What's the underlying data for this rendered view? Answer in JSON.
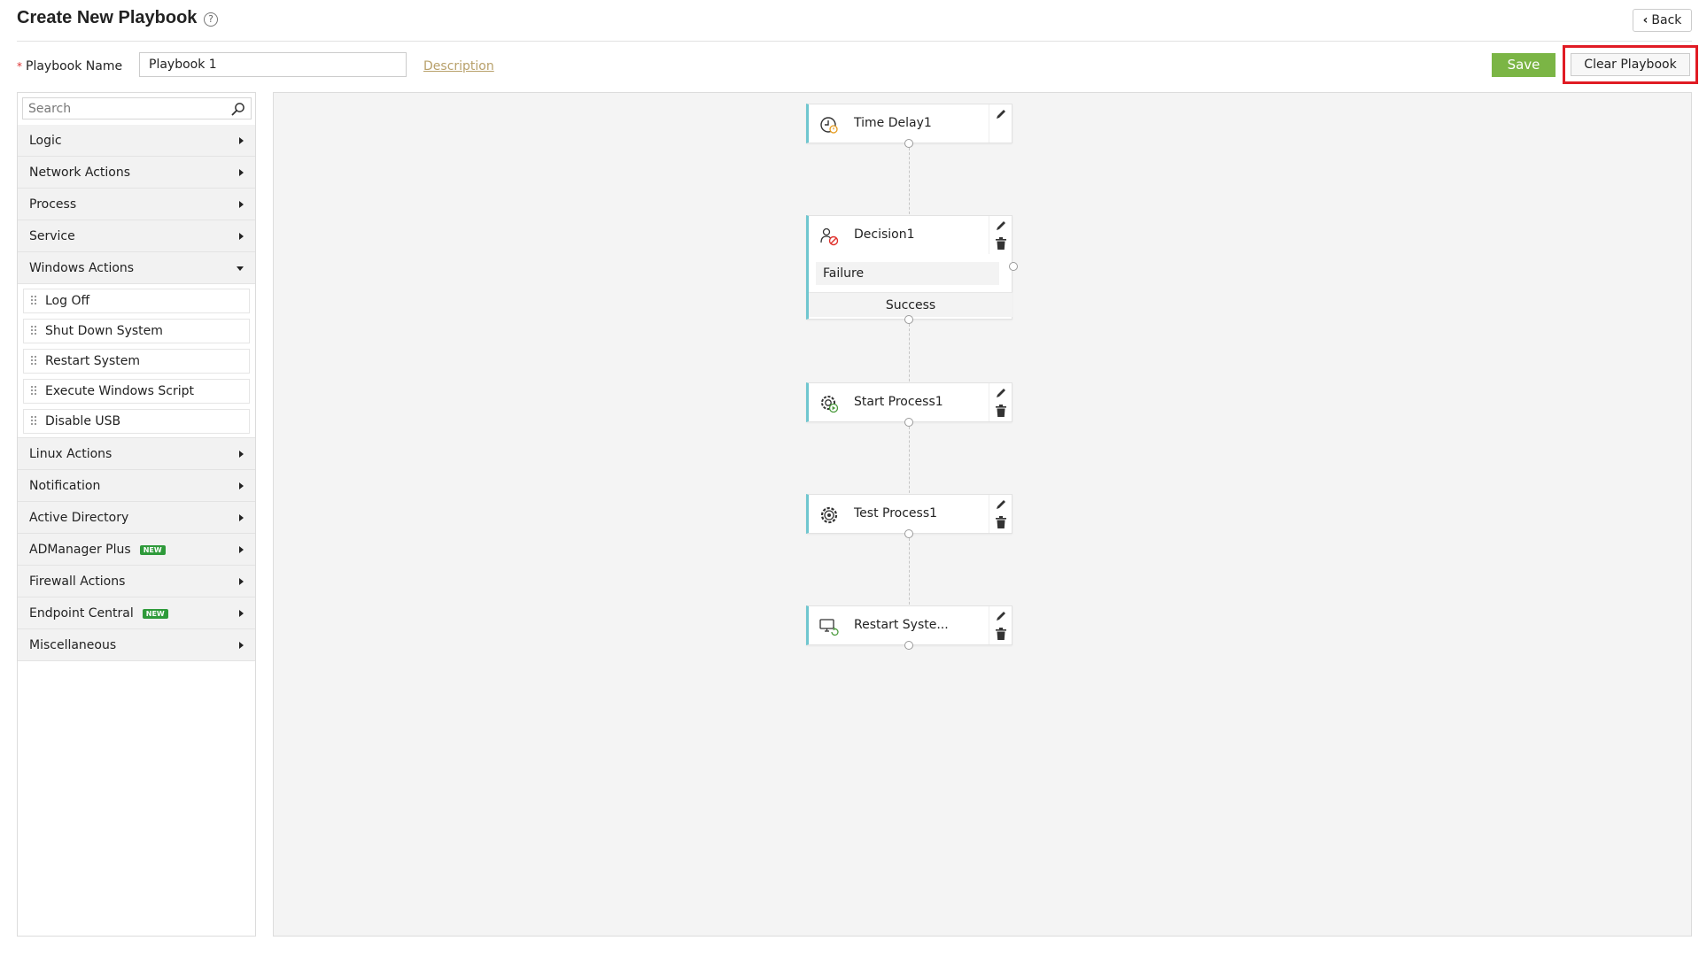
{
  "header": {
    "title": "Create New Playbook",
    "help_glyph": "?",
    "back_label": "Back"
  },
  "form": {
    "name_label": "Playbook Name",
    "required_mark": "*",
    "name_value": "Playbook 1",
    "description_link": "Description",
    "save_label": "Save",
    "clear_label": "Clear Playbook"
  },
  "sidebar": {
    "search_placeholder": "Search",
    "categories_top": [
      {
        "label": "Logic"
      },
      {
        "label": "Network Actions"
      },
      {
        "label": "Process"
      },
      {
        "label": "Service"
      }
    ],
    "expanded": {
      "label": "Windows Actions",
      "items": [
        "Log Off",
        "Shut Down System",
        "Restart System",
        "Execute Windows Script",
        "Disable USB"
      ]
    },
    "categories_bottom": [
      {
        "label": "Linux Actions",
        "badge": ""
      },
      {
        "label": "Notification",
        "badge": ""
      },
      {
        "label": "Active Directory",
        "badge": ""
      },
      {
        "label": "ADManager Plus",
        "badge": "NEW"
      },
      {
        "label": "Firewall Actions",
        "badge": ""
      },
      {
        "label": "Endpoint Central",
        "badge": "NEW"
      },
      {
        "label": "Miscellaneous",
        "badge": ""
      }
    ]
  },
  "canvas": {
    "nodes": [
      {
        "id": "time-delay",
        "label": "Time Delay1",
        "icon": "clock-icon",
        "deletable": false
      },
      {
        "id": "decision",
        "label": "Decision1",
        "icon": "decision-icon",
        "deletable": true,
        "failure_label": "Failure",
        "success_label": "Success"
      },
      {
        "id": "start-process",
        "label": "Start Process1",
        "icon": "gear-play-icon",
        "deletable": true
      },
      {
        "id": "test-process",
        "label": "Test Process1",
        "icon": "gear-icon",
        "deletable": true
      },
      {
        "id": "restart-system",
        "label": "Restart Syste...",
        "icon": "monitor-restart-icon",
        "deletable": true
      }
    ]
  },
  "colors": {
    "save": "#7bb545",
    "highlight": "#e01b24",
    "node_accent": "#6fc6cf",
    "badge": "#2e9a3a",
    "description": "#b8a06a"
  }
}
